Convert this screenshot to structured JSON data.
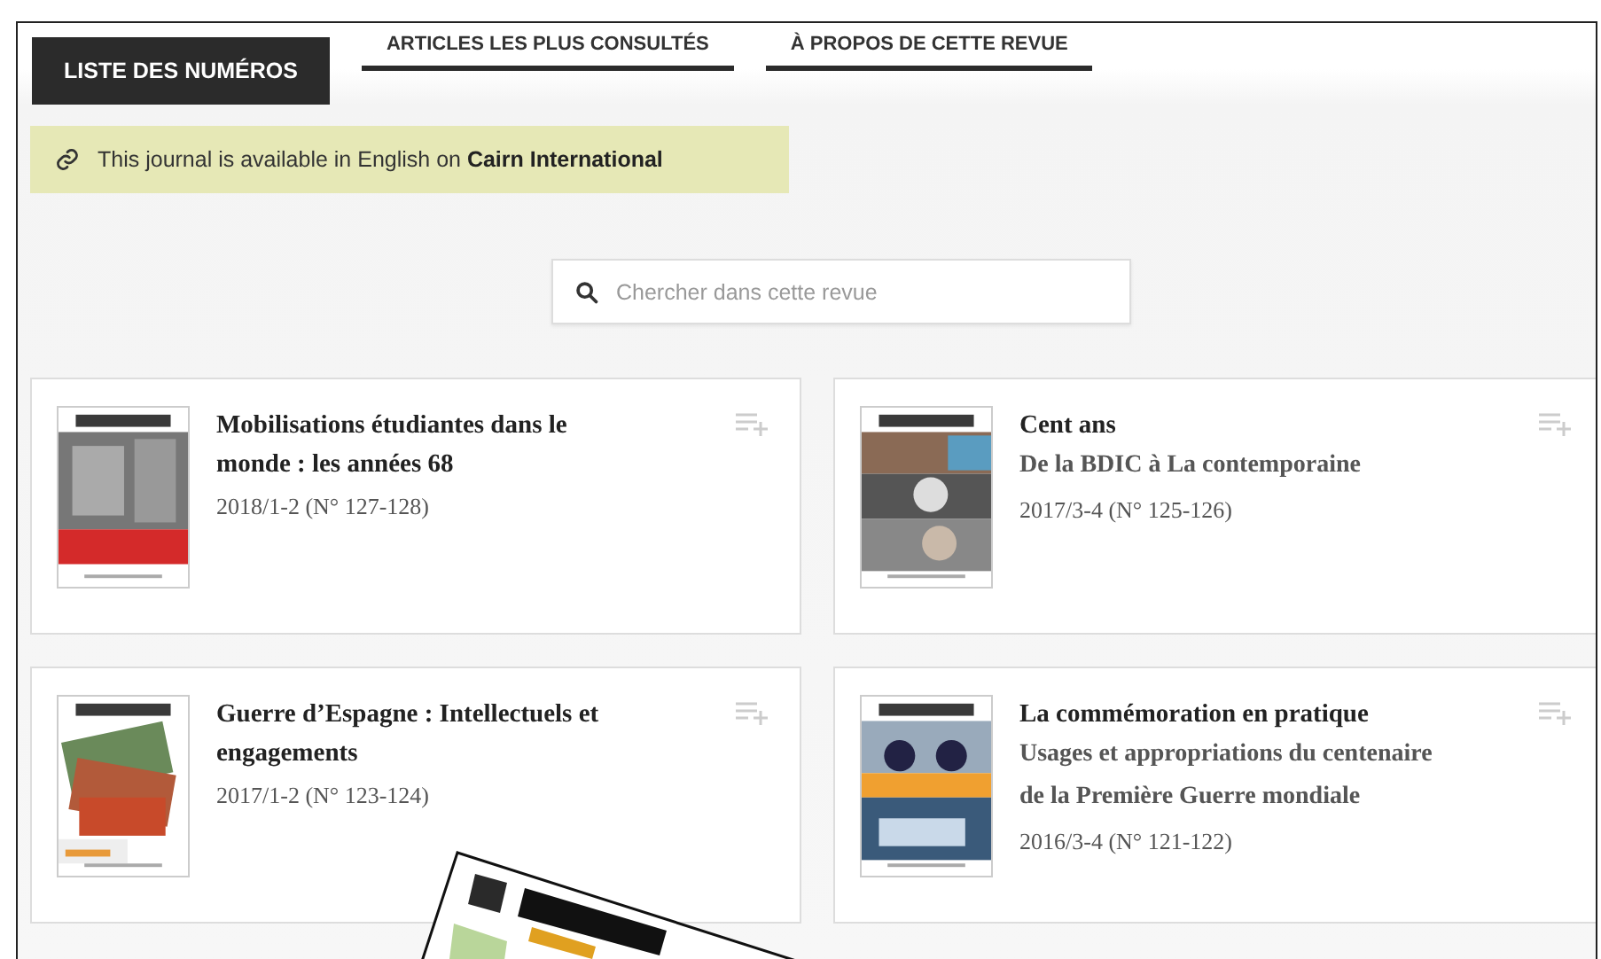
{
  "tabs": [
    {
      "label": "LISTE DES NUMÉROS",
      "selected": true
    },
    {
      "label": "ARTICLES LES PLUS CONSULTÉS",
      "selected": false
    },
    {
      "label": "À PROPOS DE CETTE REVUE",
      "selected": false
    }
  ],
  "banner": {
    "text": "This journal is available in English on **Cairn International**"
  },
  "search": {
    "placeholder": "Chercher dans cette revue"
  },
  "issues": [
    {
      "title": "Mobilisations étudiantes dans le monde : les années 68",
      "date": "2018/1-2 (N° 127-128)"
    },
    {
      "title": "Cent ans",
      "subtitle": "De la BDIC à La contemporaine",
      "date": "2017/3-4 (N° 125-126)"
    },
    {
      "title": "Guerre d’Espagne : Intellectuels et engagements",
      "date": "2017/1-2 (N° 123-124)"
    },
    {
      "title": "La commémoration en pratique",
      "subtitle": "Usages et appropriations du centenaire de la Première Guerre mondiale",
      "date": "2016/3-4 (N° 121-122)"
    }
  ]
}
